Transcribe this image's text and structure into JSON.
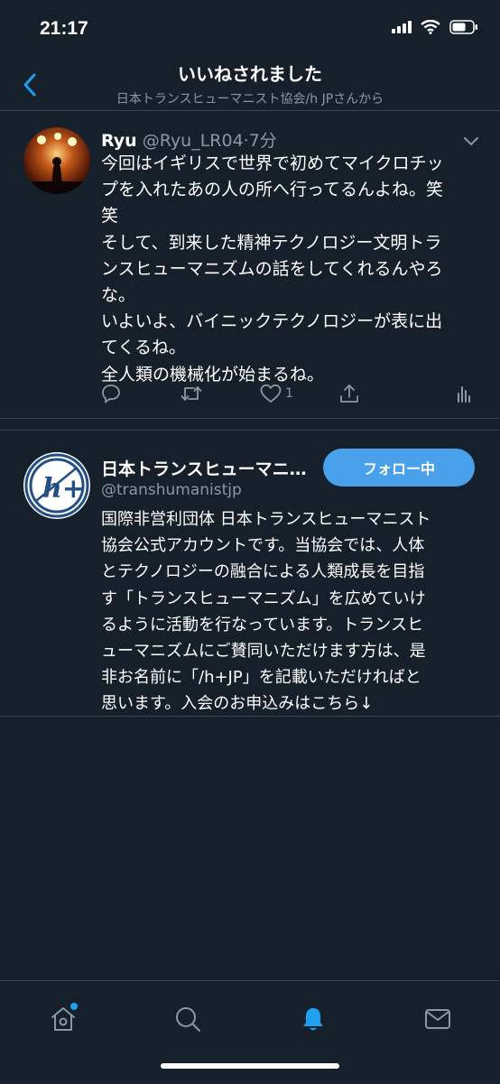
{
  "status_bar": {
    "time": "21:17"
  },
  "header": {
    "title": "いいねされました",
    "subtitle": "日本トランスヒューマニスト協会/h JPさんから"
  },
  "tweet": {
    "name": "Ryu",
    "handle": "@Ryu_LR04",
    "time": "·7分",
    "lines": [
      "今回はイギリスで世界で初めてマイクロチッ",
      "プを入れたあの人の所へ行ってるんよね。笑",
      "笑",
      "そして、到来した精神テクノロジー文明トラ",
      "ンスヒューマニズムの話をしてくれるんやろ",
      "な。",
      "いよいよ、バイニックテクノロジーが表に出",
      "てくるね。",
      "全人類の機械化が始まるね。"
    ],
    "like_count": "1"
  },
  "profile": {
    "name": "日本トランスヒューマニスト協会/h JP",
    "handle": "@transhumanistjp",
    "follow_label": "フォロー中",
    "logo_text": "h+",
    "bio_lines": [
      "国際非営利団体 日本トランスヒューマニスト",
      "協会公式アカウントです。当協会では、人体",
      "とテクノロジーの融合による人類成長を目指",
      "す「トランスヒューマニズム」を広めていけ",
      "るように活動を行なっています。トランスヒ",
      "ューマニズムにご賛同いただけます方は、是",
      "非お名前に「/h+JP」を記載いただければと",
      "思います。入会のお申込みはこちら↓"
    ]
  },
  "colors": {
    "background": "#15202b",
    "accent": "#1da1f2",
    "button": "#4aa1eb",
    "muted": "#8899a6"
  },
  "icons": [
    "back-chevron-icon",
    "reply-icon",
    "retweet-icon",
    "like-icon",
    "share-icon",
    "analytics-icon",
    "home-icon",
    "search-icon",
    "notifications-icon",
    "messages-icon"
  ]
}
